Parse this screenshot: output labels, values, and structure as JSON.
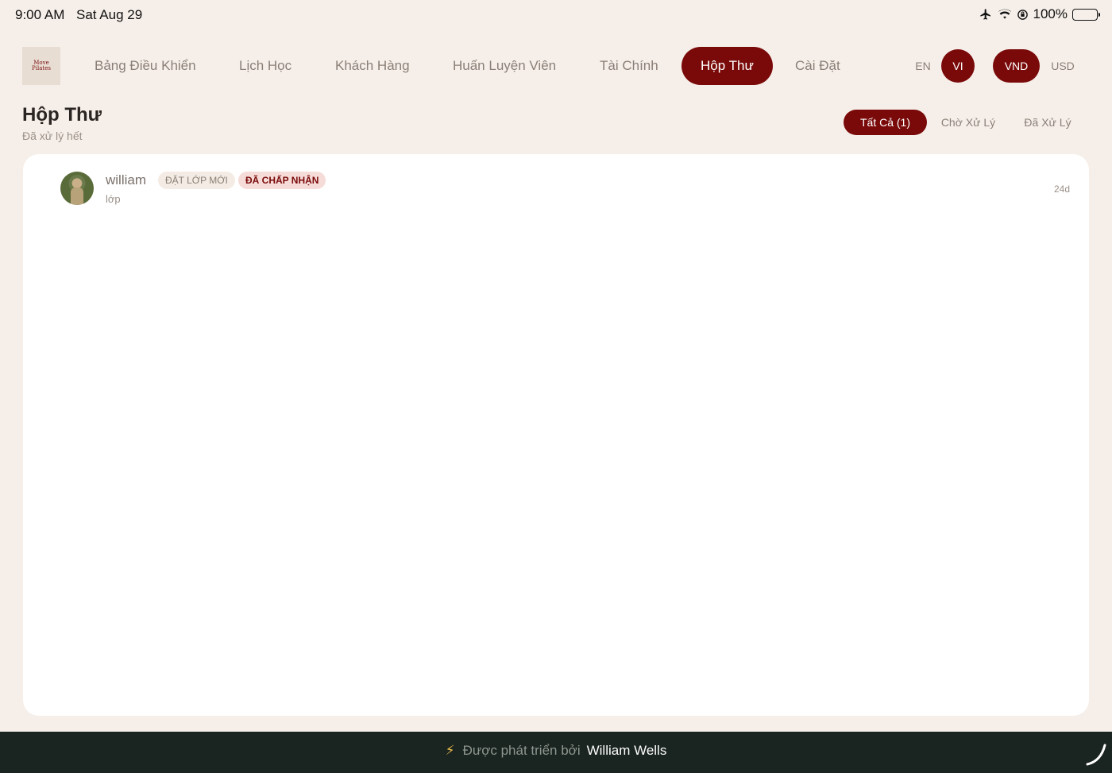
{
  "status": {
    "time": "9:00 AM",
    "date": "Sat Aug 29",
    "battery_percent": "100%",
    "icons": [
      "airplane-icon",
      "wifi-icon",
      "rotation-lock-icon",
      "battery-icon"
    ]
  },
  "brand": {
    "logo_line1": "Move",
    "logo_line2": "Pilates"
  },
  "nav": {
    "items": [
      {
        "label": "Bảng Điều Khiển",
        "active": false
      },
      {
        "label": "Lịch Học",
        "active": false
      },
      {
        "label": "Khách Hàng",
        "active": false
      },
      {
        "label": "Huấn Luyện Viên",
        "active": false
      },
      {
        "label": "Tài Chính",
        "active": false
      },
      {
        "label": "Hộp Thư",
        "active": true
      },
      {
        "label": "Cài Đặt",
        "active": false
      }
    ],
    "languages": [
      {
        "label": "EN",
        "active": false
      },
      {
        "label": "VI",
        "active": true
      }
    ],
    "currencies": [
      {
        "label": "VND",
        "active": true
      },
      {
        "label": "USD",
        "active": false
      }
    ]
  },
  "page": {
    "title": "Hộp Thư",
    "subtitle": "Đã xử lý hết"
  },
  "filters": [
    {
      "label": "Tất Cả (1)",
      "active": true
    },
    {
      "label": "Chờ Xử Lý",
      "active": false
    },
    {
      "label": "Đã Xử Lý",
      "active": false
    }
  ],
  "messages": [
    {
      "sender": "william",
      "type_badge": "ĐẶT LỚP MỚI",
      "status_badge": "ĐÃ CHẤP NHẬN",
      "preview": "lớp",
      "age": "24d"
    }
  ],
  "footer": {
    "label": "Được phát triển bởi",
    "author": "William Wells"
  },
  "colors": {
    "accent": "#7a0a0a",
    "background": "#f6efe9",
    "footer": "#1a2420"
  }
}
